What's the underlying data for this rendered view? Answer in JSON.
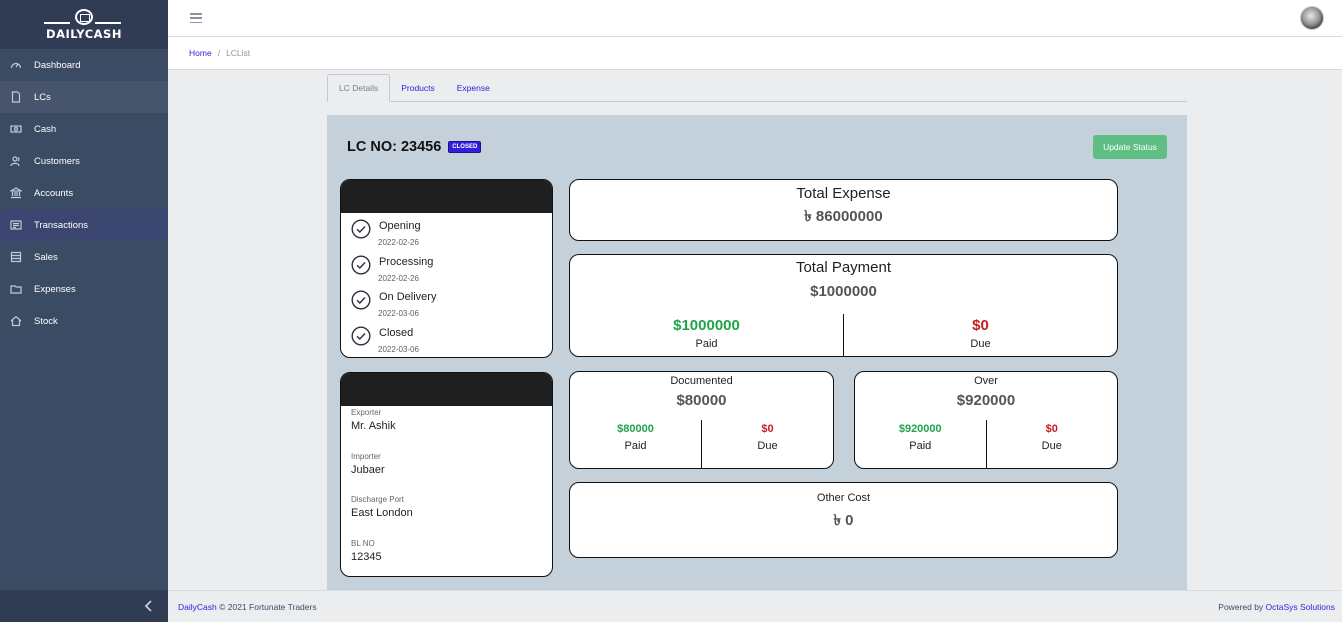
{
  "brand": {
    "name": "DAILYCASH"
  },
  "sidebar": {
    "items": [
      {
        "label": "Dashboard",
        "icon": "speedometer-icon"
      },
      {
        "label": "LCs",
        "icon": "file-icon"
      },
      {
        "label": "Cash",
        "icon": "cash-icon"
      },
      {
        "label": "Customers",
        "icon": "people-icon"
      },
      {
        "label": "Accounts",
        "icon": "bank-icon"
      },
      {
        "label": "Transactions",
        "icon": "list-icon"
      },
      {
        "label": "Sales",
        "icon": "spreadsheet-icon"
      },
      {
        "label": "Expenses",
        "icon": "folder-icon"
      },
      {
        "label": "Stock",
        "icon": "home-icon"
      }
    ]
  },
  "breadcrumb": {
    "home": "Home",
    "separator": "/",
    "current": "LCList"
  },
  "tabs": [
    {
      "label": "LC Details",
      "active": true
    },
    {
      "label": "Products",
      "active": false
    },
    {
      "label": "Expense",
      "active": false
    }
  ],
  "lc": {
    "title": "LC NO: 23456",
    "status_badge": "CLOSED",
    "update_button": "Update Status"
  },
  "timeline": [
    {
      "label": "Opening",
      "date": "2022-02-26"
    },
    {
      "label": "Processing",
      "date": "2022-02-26"
    },
    {
      "label": "On Delivery",
      "date": "2022-03-06"
    },
    {
      "label": "Closed",
      "date": "2022-03-06"
    }
  ],
  "info": [
    {
      "label": "Exporter",
      "value": "Mr. Ashik"
    },
    {
      "label": "Importer",
      "value": "Jubaer"
    },
    {
      "label": "Discharge Port",
      "value": "East London"
    },
    {
      "label": "BL NO",
      "value": "12345"
    }
  ],
  "total_expense": {
    "title": "Total Expense",
    "value": "৳ 86000000"
  },
  "total_payment": {
    "title": "Total Payment",
    "value": "$1000000",
    "paid_amount": "$1000000",
    "paid_label": "Paid",
    "due_amount": "$0",
    "due_label": "Due"
  },
  "documented": {
    "title": "Documented",
    "value": "$80000",
    "paid_amount": "$80000",
    "paid_label": "Paid",
    "due_amount": "$0",
    "due_label": "Due"
  },
  "over": {
    "title": "Over",
    "value": "$920000",
    "paid_amount": "$920000",
    "paid_label": "Paid",
    "due_amount": "$0",
    "due_label": "Due"
  },
  "other_cost": {
    "title": "Other Cost",
    "value": "৳ 0"
  },
  "footer": {
    "brand_link": "DailyCash",
    "copyright": "© 2021 Fortunate Traders",
    "powered_prefix": "Powered by",
    "powered_link": "OctaSys Solutions"
  },
  "colors": {
    "sidebar": "#3c4b64",
    "accent": "#321fdb",
    "success": "#22a34a",
    "danger": "#c81e1e",
    "button": "#5fbf83",
    "panel": "#c4d0da"
  }
}
